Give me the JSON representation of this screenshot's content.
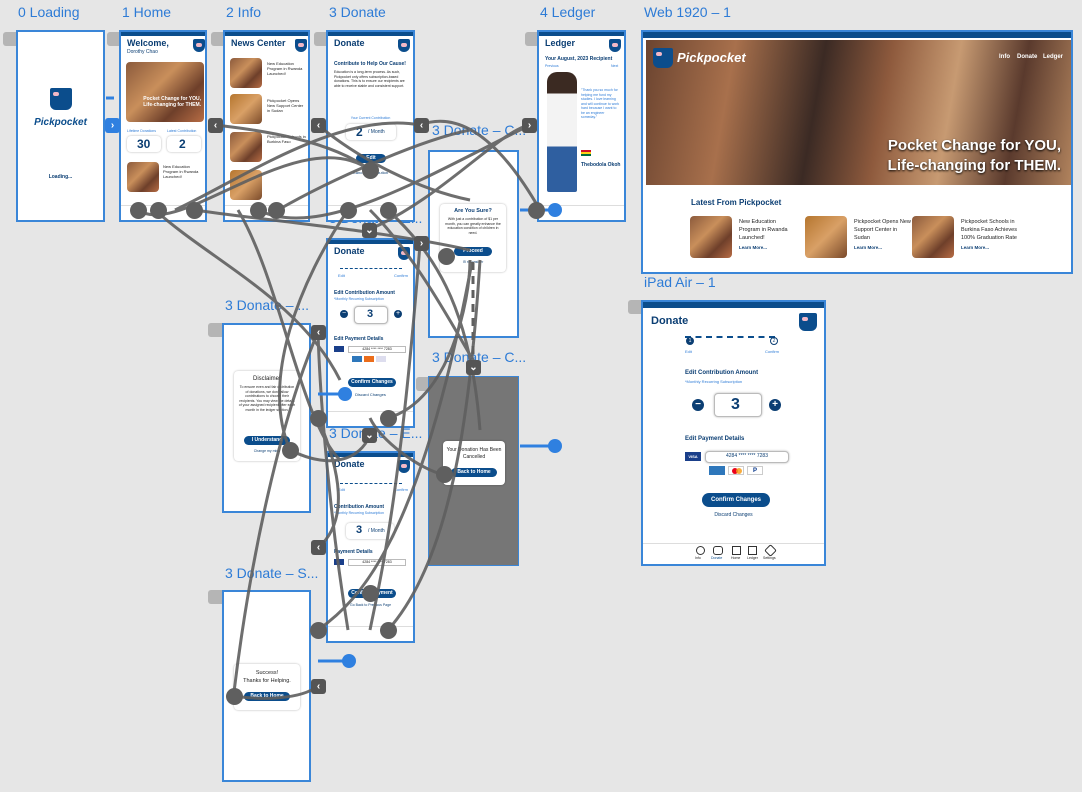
{
  "frames": {
    "loading": "0 Loading",
    "home": "1 Home",
    "info": "2 Info",
    "donate": "3 Donate",
    "ledger": "4 Ledger",
    "web": "Web 1920 – 1",
    "ipad": "iPad Air – 1",
    "donate_e1": "3 Donate – E...",
    "donate_c1": "3 Donate – C...",
    "donate_dots": "3 Donate – ...",
    "donate_c2": "3 Donate – C...",
    "donate_e2": "3 Donate – E...",
    "donate_s": "3 Donate – S..."
  },
  "brand": "Pickpocket",
  "loading_text": "Loading...",
  "home": {
    "title": "Welcome,",
    "user": "Dorothy Chao",
    "hero": "Pocket Change for YOU, Life-changing for THEM.",
    "stat1_label": "Lifetime Donations",
    "stat1_value": "30",
    "stat2_label": "Latest Contribution",
    "stat2_value": "2",
    "news": "New Education Program in Rwanda Launched!"
  },
  "info": {
    "title": "News Center",
    "n1": "New Education Program in Rwanda Launched!",
    "n2": "Pickpocket Opens New Support Center in Sudan",
    "n3": "Pickpocket Schools in Burkina Faso",
    "more": "Learn More..."
  },
  "donate": {
    "title": "Donate",
    "heading": "Contribute to Help Our Cause!",
    "body": "Education is a long-term process. As such, Pickpocket only offers subscription-based donations. This is to ensure our recipients are able to receive stable and consistent support.",
    "current": "Your Current Contribution",
    "amount": "2",
    "per": "/ Month",
    "edit": "Edit",
    "cancel": "Cancel Contribution"
  },
  "ledger": {
    "title": "Ledger",
    "recipient": "Your August, 2023 Recipient",
    "prev": "Previous",
    "next": "Next",
    "quote": "\"Thank you so much for helping me fund my studies. I love learning and will continue to work hard because I want to be an engineer someday.\"",
    "name": "Thebodola Okoh"
  },
  "confirm": {
    "title": "Are You Sure?",
    "body": "With just a contribution of $1 per month, you can greatly enhance the education condition of children in need.",
    "proceed": "Proceed",
    "reconsider": "I'll reconsider"
  },
  "edit": {
    "step1": "Edit",
    "step2": "Confirm",
    "contrib": "Edit Contribution Amount",
    "sub": "*Monthly Recurring Subscription",
    "amount": "3",
    "payment": "Edit Payment Details",
    "card": "4284  ****  ****  7283",
    "confirm_btn": "Confirm Changes",
    "discard": "Discard Changes"
  },
  "disclaimer": {
    "title": "Disclaimer",
    "body": "To ensure even and fair distribution of donations, we don't allow contributions to choose their recipients. You may view the details of your assigned recipient after each month in the ledger section.",
    "btn": "I Understand",
    "back": "Change my mind"
  },
  "cancelled": {
    "text": "Your Donation Has Been Cancelled",
    "btn": "Back to Home"
  },
  "edit2": {
    "contrib": "Contribution Amount",
    "sub": "*Monthly Recurring Subscription",
    "amount": "3",
    "per": "/ Month",
    "payment": "Payment Details",
    "card": "4284  ****  ****  7283",
    "btn": "Confirm Payment",
    "back": "Go Back to Previous Page"
  },
  "success": {
    "line1": "Success!",
    "line2": "Thanks for Helping.",
    "btn": "Back to Home"
  },
  "web": {
    "nav": [
      "Info",
      "Donate",
      "Ledger"
    ],
    "hero1": "Pocket Change for YOU,",
    "hero2": "Life-changing for THEM.",
    "latest": "Latest From Pickpocket",
    "n1": "New Education Program in Rwanda Launched!",
    "n2": "Pickpocket Opens New Support Center in Sudan",
    "n3": "Pickpocket Schools in Burkina Faso Achieves 100% Graduation Rate",
    "more": "Learn More..."
  },
  "ipad": {
    "title": "Donate",
    "step1": "Edit",
    "step2": "Confirm",
    "contrib": "Edit Contribution Amount",
    "sub": "*Monthly Recurring Subscription",
    "amount": "3",
    "payment": "Edit Payment Details",
    "card": "4284  ****  ****  7283",
    "btn": "Confirm Changes",
    "discard": "Discard Changes",
    "nav": [
      "Info",
      "Donate",
      "Home",
      "Ledger",
      "Settings"
    ]
  },
  "nav_small": [
    "Info",
    "Donate",
    "Home",
    "Ledger",
    "Settings"
  ],
  "colors": {
    "canvas": "#e6e6e6",
    "frame_border": "#3a86d8",
    "brand_navy": "#0b4d8c",
    "connector": "#5f5f5f"
  }
}
